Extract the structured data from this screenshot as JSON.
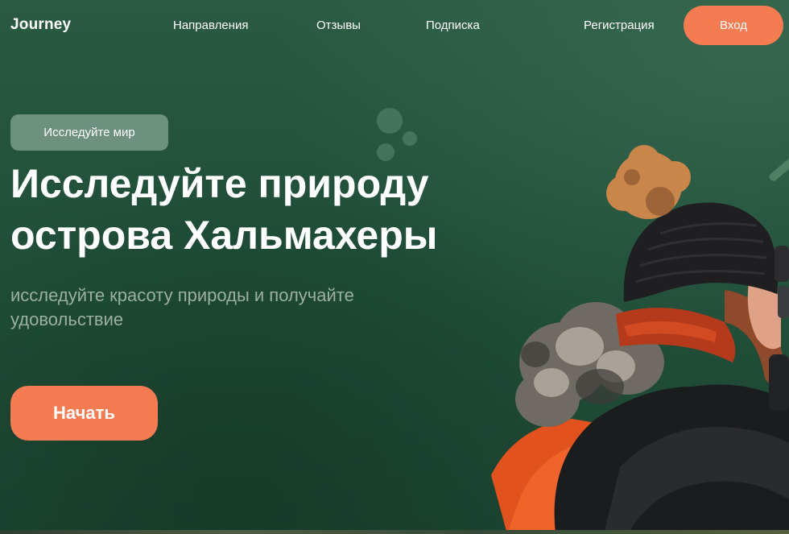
{
  "brand": {
    "logo": "Journey"
  },
  "nav": {
    "links": [
      "Направления",
      "Отзывы",
      "Подписка"
    ],
    "register": "Регистрация",
    "login": "Вход"
  },
  "hero": {
    "tag": "Исследуйте мир",
    "title": "Исследуйте природу острова Хальмахеры",
    "subtitle": "исследуйте красоту природы и получайте удовольствие",
    "cta": "Начать"
  },
  "colors": {
    "background": "#24513a",
    "accent": "#f47b52",
    "subtitle": "#9bb0a2"
  }
}
